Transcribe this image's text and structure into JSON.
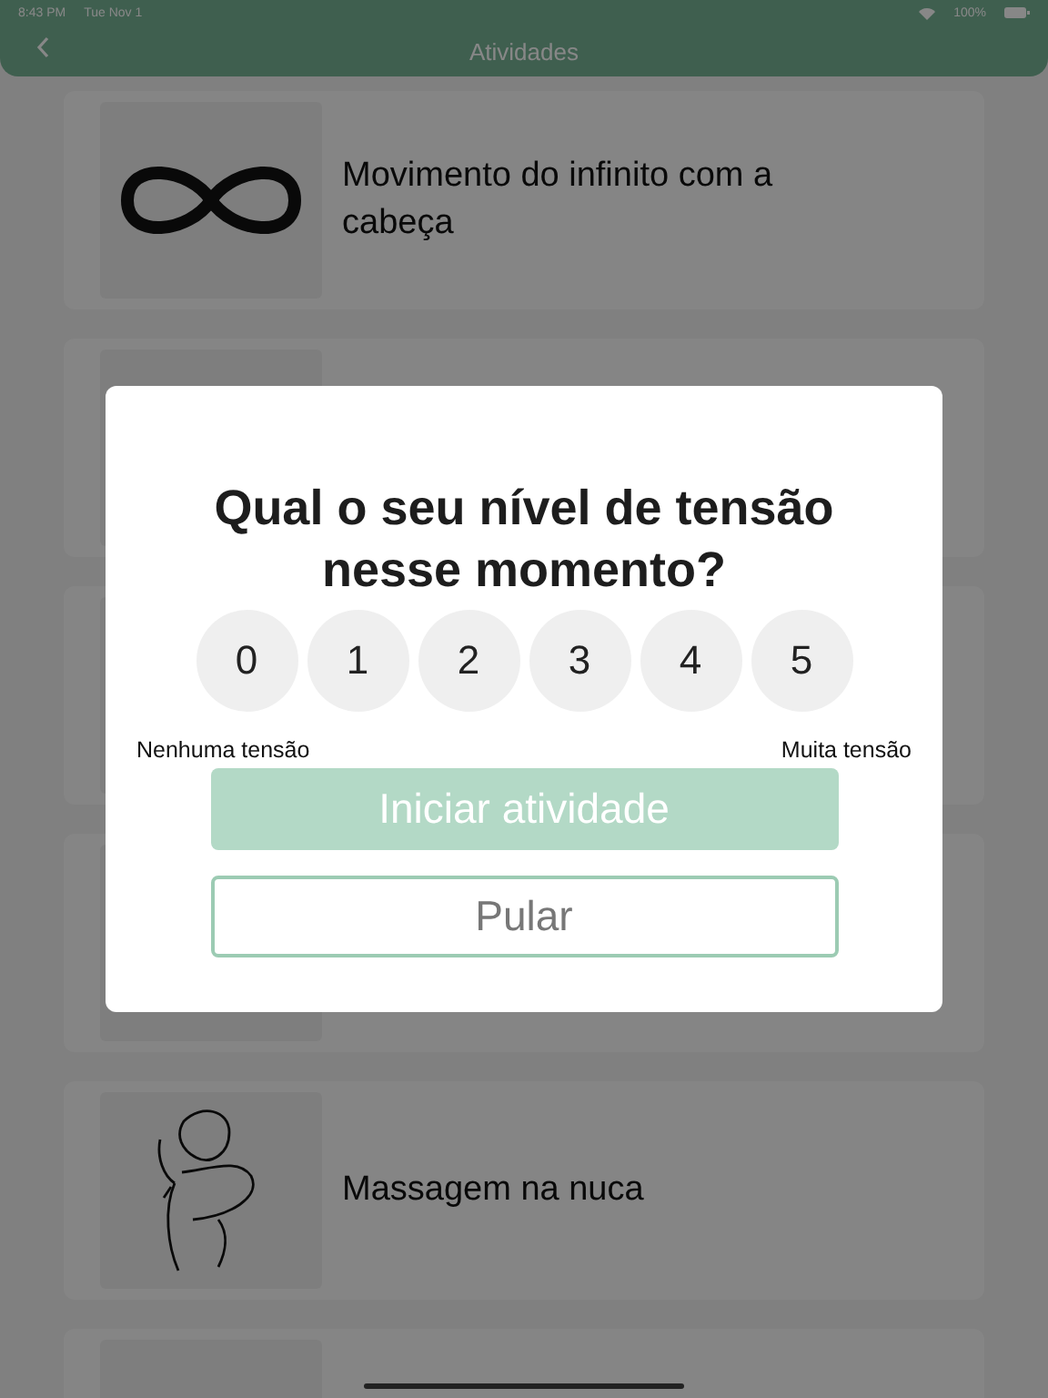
{
  "status_bar": {
    "time": "8:43 PM",
    "date": "Tue Nov 1",
    "battery": "100%"
  },
  "header": {
    "title": "Atividades"
  },
  "activities": [
    {
      "kind": "infinity",
      "title": "Movimento do infinito com a cabeça"
    },
    {
      "kind": "blank"
    },
    {
      "kind": "blank"
    },
    {
      "kind": "blank"
    },
    {
      "kind": "neck",
      "title": "Massagem na nuca"
    },
    {
      "kind": "blank"
    }
  ],
  "modal": {
    "question": "Qual o seu nível de tensão nesse momento?",
    "options": [
      {
        "label": "0",
        "selected": false
      },
      {
        "label": "1",
        "selected": false
      },
      {
        "label": "2",
        "selected": false
      },
      {
        "label": "3",
        "selected": false
      },
      {
        "label": "4",
        "selected": false
      },
      {
        "label": "5",
        "selected": false
      }
    ],
    "min_label": "Nenhuma tensão",
    "max_label": "Muita tensão",
    "start_button": {
      "label": "Iniciar atividade",
      "disabled": true
    },
    "skip_button": {
      "label": "Pular"
    }
  }
}
